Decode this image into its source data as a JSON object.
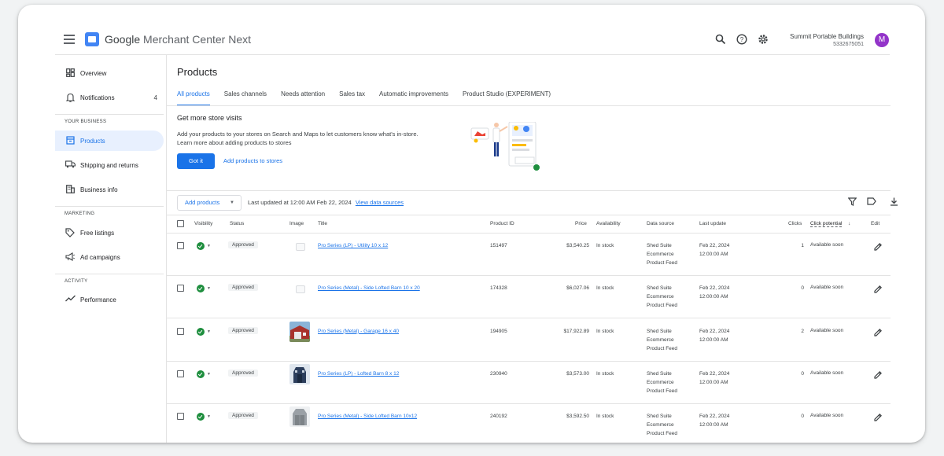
{
  "app": {
    "title_brand": "Google",
    "title_product": "Merchant Center Next",
    "account_name": "Summit Portable Buildings",
    "account_id": "5332675051",
    "avatar_letter": "M"
  },
  "sidebar": {
    "items_top": [
      {
        "label": "Overview",
        "icon": "dashboard-icon"
      },
      {
        "label": "Notifications",
        "icon": "bell-icon",
        "count": "4"
      }
    ],
    "section_business": "YOUR BUSINESS",
    "items_business": [
      {
        "label": "Products",
        "icon": "storefront-icon",
        "active": true
      },
      {
        "label": "Shipping and returns",
        "icon": "truck-icon"
      },
      {
        "label": "Business info",
        "icon": "building-icon"
      }
    ],
    "section_marketing": "MARKETING",
    "items_marketing": [
      {
        "label": "Free listings",
        "icon": "tag-icon"
      },
      {
        "label": "Ad campaigns",
        "icon": "megaphone-icon"
      }
    ],
    "section_activity": "ACTIVITY",
    "items_activity": [
      {
        "label": "Performance",
        "icon": "trending-icon"
      }
    ]
  },
  "main": {
    "title": "Products",
    "tabs": [
      {
        "label": "All products",
        "active": true
      },
      {
        "label": "Sales channels"
      },
      {
        "label": "Needs attention"
      },
      {
        "label": "Sales tax"
      },
      {
        "label": "Automatic improvements"
      },
      {
        "label": "Product Studio (EXPERIMENT)"
      }
    ],
    "promo": {
      "title": "Get more store visits",
      "line1": "Add your products to your stores on Search and Maps to let customers know what's in-store.",
      "line2": "Learn more about adding products to stores",
      "primary_button": "Got it",
      "link_button": "Add products to stores"
    },
    "toolbar": {
      "add_button": "Add products",
      "updated_text": "Last updated at 12:00 AM Feb 22, 2024",
      "view_link": "View data sources"
    },
    "table": {
      "headers": {
        "visibility": "Visibility",
        "status": "Status",
        "image": "Image",
        "title": "Title",
        "product_id": "Product ID",
        "price": "Price",
        "availability": "Availability",
        "data_source": "Data source",
        "last_update": "Last update",
        "clicks": "Clicks",
        "click_potential": "Click potential",
        "edit": "Edit"
      },
      "rows": [
        {
          "status": "Approved",
          "image": "placeholder",
          "title": "Pro Series (LP) - Utility 10 x 12",
          "product_id": "151497",
          "price": "$3,540.25",
          "availability": "In stock",
          "source1": "Shed Suite",
          "source2": "Ecommerce",
          "source3": "Product Feed",
          "update1": "Feb 22, 2024",
          "update2": "12:00:00 AM",
          "clicks": "1",
          "potential": "Available soon"
        },
        {
          "status": "Approved",
          "image": "placeholder",
          "title": "Pro Series (Metal) - Side Lofted Barn 10 x 20",
          "product_id": "174328",
          "price": "$6,027.06",
          "availability": "In stock",
          "source1": "Shed Suite",
          "source2": "Ecommerce",
          "source3": "Product Feed",
          "update1": "Feb 22, 2024",
          "update2": "12:00:00 AM",
          "clicks": "0",
          "potential": "Available soon"
        },
        {
          "status": "Approved",
          "image": "garage-red",
          "title": "Pro Series (Metal) - Garage 16 x 40",
          "product_id": "194905",
          "price": "$17,922.89",
          "availability": "In stock",
          "source1": "Shed Suite",
          "source2": "Ecommerce",
          "source3": "Product Feed",
          "update1": "Feb 22, 2024",
          "update2": "12:00:00 AM",
          "clicks": "2",
          "potential": "Available soon"
        },
        {
          "status": "Approved",
          "image": "barn-dark",
          "title": "Pro Series (LP) - Lofted Barn 8 x 12",
          "product_id": "230940",
          "price": "$3,573.00",
          "availability": "In stock",
          "source1": "Shed Suite",
          "source2": "Ecommerce",
          "source3": "Product Feed",
          "update1": "Feb 22, 2024",
          "update2": "12:00:00 AM",
          "clicks": "0",
          "potential": "Available soon"
        },
        {
          "status": "Approved",
          "image": "barn-gray",
          "title": "Pro Series (Metal) - Side Lofted Barn 10x12",
          "product_id": "240192",
          "price": "$3,592.50",
          "availability": "In stock",
          "source1": "Shed Suite",
          "source2": "Ecommerce",
          "source3": "Product Feed",
          "update1": "Feb 22, 2024",
          "update2": "12:00:00 AM",
          "clicks": "0",
          "potential": "Available soon"
        }
      ]
    }
  },
  "colors": {
    "accent": "#1a73e8",
    "active_bg": "#e8f0fe",
    "visible_green": "#1e8e3e",
    "avatar": "#9334c9"
  }
}
